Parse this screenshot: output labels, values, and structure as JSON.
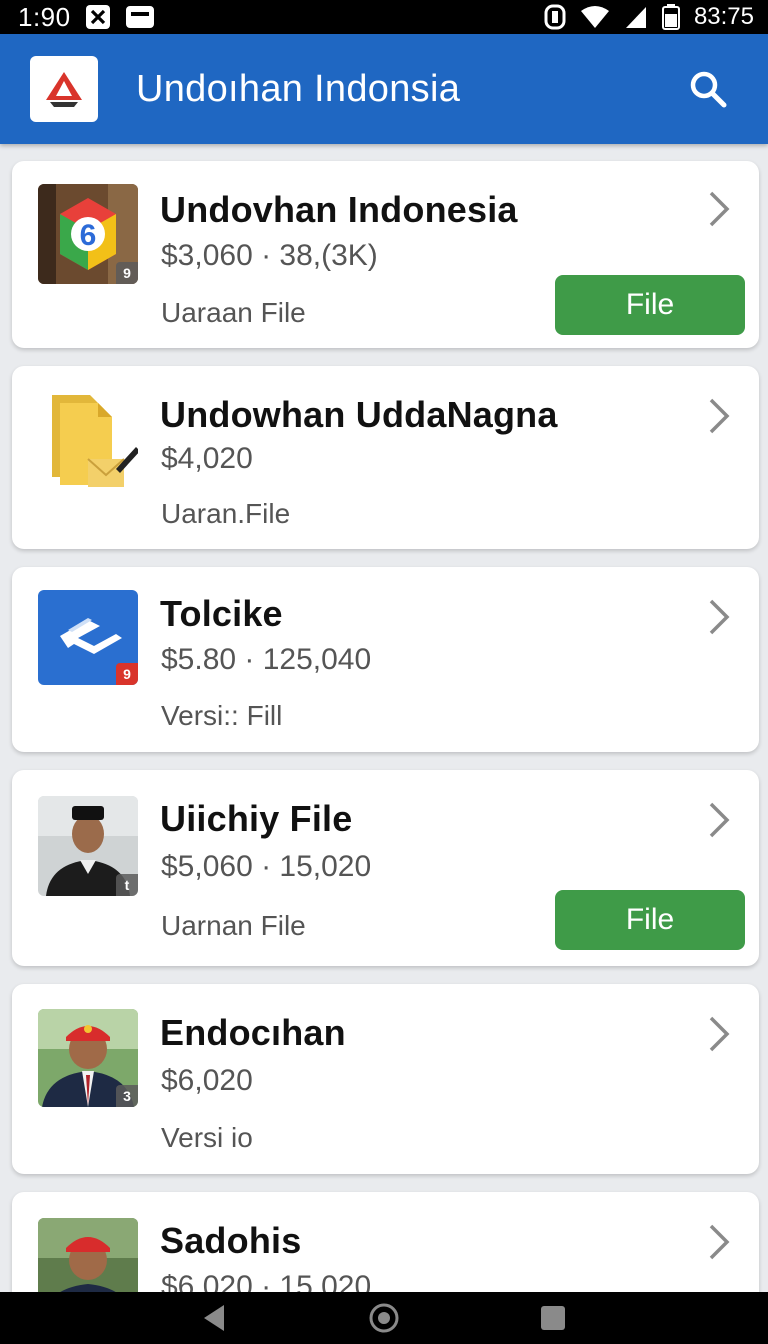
{
  "status_bar": {
    "time": "1:90",
    "clock": "83:75"
  },
  "app_bar": {
    "title": "Undoıhan Indonsia"
  },
  "items": [
    {
      "title": "Undovhan Indonesia",
      "meta": "$3,060 · 38,(3K)",
      "sub": "Uaraan File",
      "button": "File",
      "badge": "9"
    },
    {
      "title": "Undowhan UddaNagna",
      "meta": "$4,020",
      "sub": "Uaran.File"
    },
    {
      "title": "Tolcike",
      "meta": "$5.80 · 125,040",
      "sub": "Versi:: Fill",
      "badge": "9"
    },
    {
      "title": "Uiichiy File",
      "meta": "$5,060 · 15,020",
      "sub": "Uarnan File",
      "button": "File",
      "badge": "t"
    },
    {
      "title": "Endocıhan",
      "meta": "$6,020",
      "sub": "Versi io",
      "badge": "3"
    },
    {
      "title": "Sadohis",
      "meta": "$6,020 · 15,020"
    }
  ],
  "colors": {
    "app_bar": "#1f67c2",
    "button_green": "#3f9b48"
  }
}
